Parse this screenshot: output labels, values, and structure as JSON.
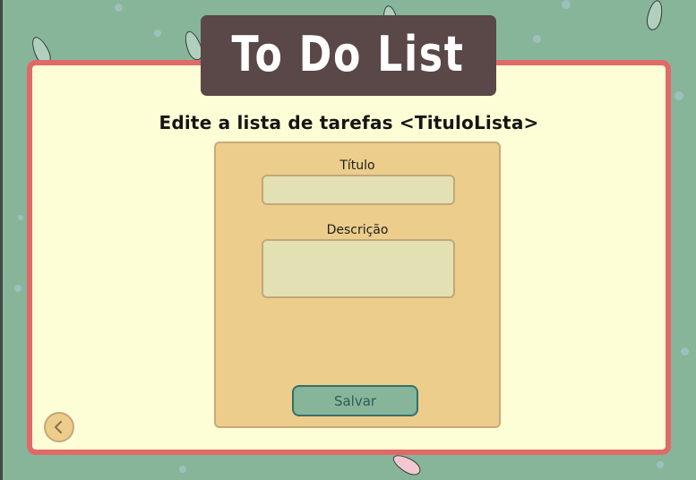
{
  "app": {
    "title": "To Do List"
  },
  "page": {
    "heading": "Edite a lista de tarefas <TituloLista>"
  },
  "form": {
    "title_label": "Título",
    "title_value": "",
    "description_label": "Descrição",
    "description_value": "",
    "save_label": "Salvar"
  },
  "navigation": {
    "back_icon": "chevron-left-icon"
  },
  "colors": {
    "background": "#86b59a",
    "card": "#fdfdd6",
    "card_border": "#e06a68",
    "banner": "#5a4747",
    "panel": "#eccd8b",
    "input": "#e3e0b3",
    "button": "#86b59a",
    "button_border": "#356f69"
  }
}
